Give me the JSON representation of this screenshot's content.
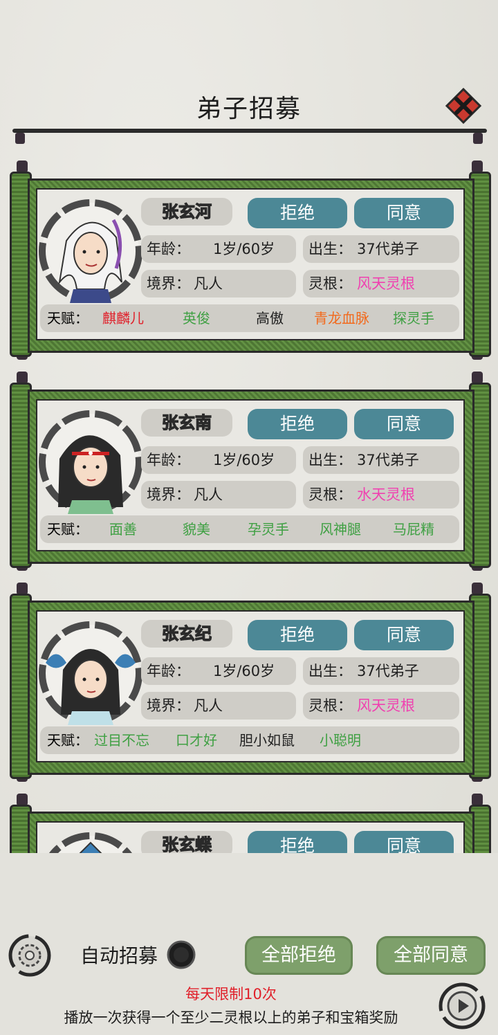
{
  "header": {
    "title": "弟子招募"
  },
  "labels": {
    "age": "年龄：",
    "birth": "出生：",
    "realm": "境界：",
    "root": "灵根：",
    "talent": "天赋："
  },
  "buttons": {
    "reject": "拒绝",
    "agree": "同意"
  },
  "disciples": [
    {
      "name": "张玄河",
      "age": "1岁/60岁",
      "birth": "37代弟子",
      "realm": "凡人",
      "root": "风天灵根",
      "talents": [
        {
          "text": "麒麟儿",
          "color": "#e0202a"
        },
        {
          "text": "英俊",
          "color": "#3fa043"
        },
        {
          "text": "高傲",
          "color": "#1f1f1f"
        },
        {
          "text": "青龙血脉",
          "color": "#f26a1d"
        },
        {
          "text": "探灵手",
          "color": "#3fa043"
        }
      ]
    },
    {
      "name": "张玄南",
      "age": "1岁/60岁",
      "birth": "37代弟子",
      "realm": "凡人",
      "root": "水天灵根",
      "talents": [
        {
          "text": "面善",
          "color": "#3fa043"
        },
        {
          "text": "貌美",
          "color": "#3fa043"
        },
        {
          "text": "孕灵手",
          "color": "#3fa043"
        },
        {
          "text": "风神腿",
          "color": "#3fa043"
        },
        {
          "text": "马屁精",
          "color": "#3fa043"
        }
      ]
    },
    {
      "name": "张玄纪",
      "age": "1岁/60岁",
      "birth": "37代弟子",
      "realm": "凡人",
      "root": "风天灵根",
      "talents": [
        {
          "text": "过目不忘",
          "color": "#3fa043"
        },
        {
          "text": "口才好",
          "color": "#3fa043"
        },
        {
          "text": "胆小如鼠",
          "color": "#1f1f1f"
        },
        {
          "text": "小聪明",
          "color": "#3fa043"
        }
      ]
    },
    {
      "name": "张玄蝶"
    }
  ],
  "colors": {
    "root": "#f040b0",
    "name_fill": "#f4e62a",
    "button": "#4c8896",
    "scroll_green": "#5e8c3f"
  },
  "footer": {
    "auto_recruit": "自动招募",
    "reject_all": "全部拒绝",
    "agree_all": "全部同意",
    "daily_limit": "每天限制10次",
    "reward_text": "播放一次获得一个至少二灵根以上的弟子和宝箱奖励"
  },
  "icons": {
    "close": "close-icon",
    "settings": "gear-icon",
    "toggle": "toggle-icon",
    "play": "play-icon"
  }
}
